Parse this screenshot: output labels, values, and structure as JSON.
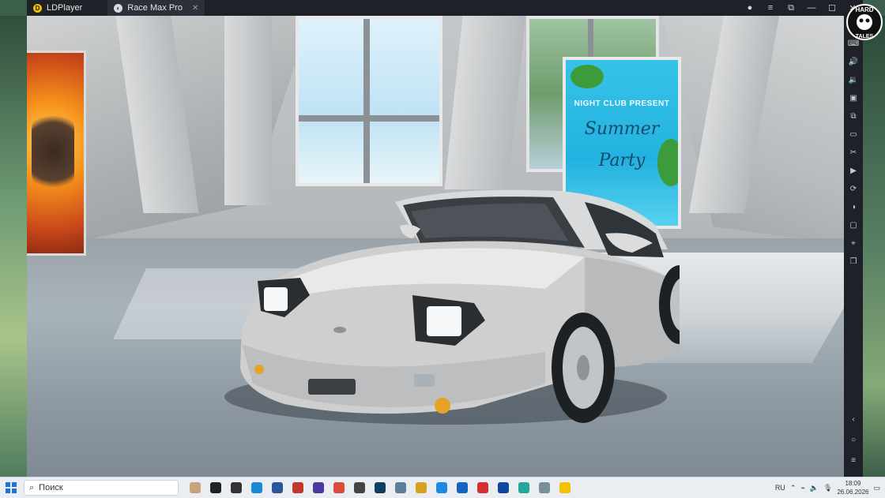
{
  "titlebar": {
    "tabs": [
      {
        "label": "LDPlayer",
        "icon": "ldplayer-logo-icon"
      },
      {
        "label": "Race Max Pro",
        "icon": "race-max-pro-icon",
        "close": "✕"
      }
    ],
    "window_controls": [
      "account-icon",
      "menu-icon",
      "screenshot-icon",
      "minimize-icon",
      "maximize-icon",
      "close-icon"
    ]
  },
  "game": {
    "poster_right": {
      "club_text": "NIGHT CLUB PRESENT",
      "headline_line1": "Summer",
      "headline_line2": "Party"
    }
  },
  "logo": {
    "line1": "HARD",
    "line2": "TALES"
  },
  "sidebar": {
    "icons": [
      "keyboard-icon",
      "volume-up-icon",
      "volume-down-icon",
      "install-apk-icon",
      "multi-instance-icon",
      "record-icon",
      "scissors-icon",
      "play-icon",
      "sync-icon",
      "rotate-icon",
      "folder-icon",
      "location-icon",
      "copy-icon"
    ],
    "nav": [
      "back-icon",
      "home-icon",
      "recents-icon"
    ]
  },
  "taskbar": {
    "search_placeholder": "Поиск",
    "apps": [
      {
        "name": "widgets-icon",
        "color": "#c9a27a"
      },
      {
        "name": "cortana-icon",
        "color": "#222222"
      },
      {
        "name": "task-view-icon",
        "color": "#333333"
      },
      {
        "name": "edge-icon",
        "color": "#1a8ad4"
      },
      {
        "name": "word-icon",
        "color": "#2b579a"
      },
      {
        "name": "app-red-icon",
        "color": "#c0392b"
      },
      {
        "name": "app-headphones-icon",
        "color": "#4a3aa0"
      },
      {
        "name": "chrome-icon",
        "color": "#dd4b39"
      },
      {
        "name": "app-film-icon",
        "color": "#444444"
      },
      {
        "name": "v-app-icon",
        "color": "#0f3f5f"
      },
      {
        "name": "app-image-icon",
        "color": "#5f7c99"
      },
      {
        "name": "app-yellow-icon",
        "color": "#d6a21e"
      },
      {
        "name": "app-blue-check-icon",
        "color": "#1e88e5"
      },
      {
        "name": "app-blue-down-icon",
        "color": "#1565c0"
      },
      {
        "name": "app-red-square-icon",
        "color": "#d32f2f"
      },
      {
        "name": "shield-app-icon",
        "color": "#0d47a1"
      },
      {
        "name": "app-teal-icon",
        "color": "#26a69a"
      },
      {
        "name": "app-gray-icon",
        "color": "#78909c"
      },
      {
        "name": "ldplayer-taskbar-icon",
        "color": "#f2c200"
      }
    ],
    "tray": {
      "lang": "RU",
      "time": "18:09",
      "date": "26.06.2026"
    }
  }
}
